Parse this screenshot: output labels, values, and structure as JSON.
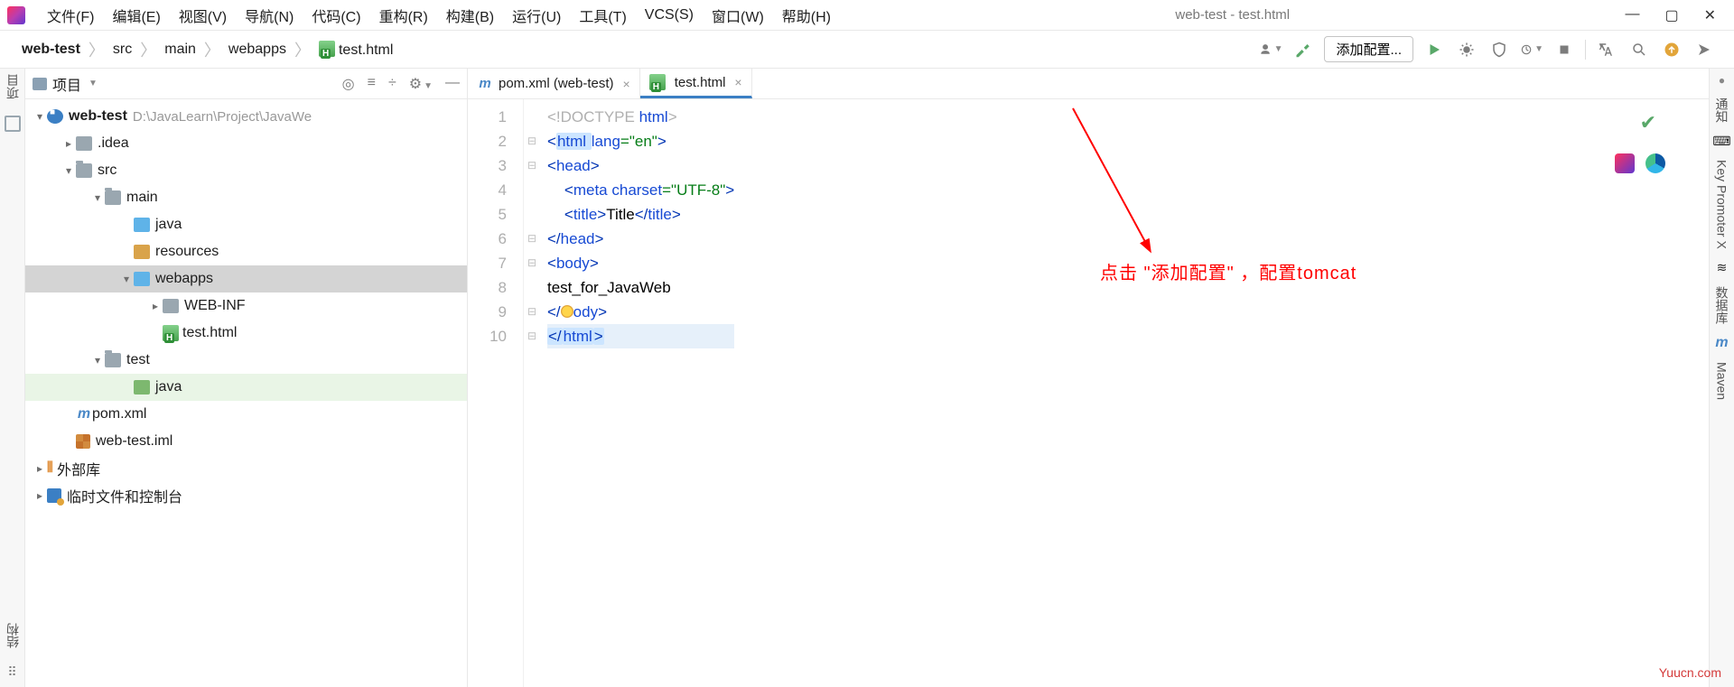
{
  "window": {
    "title": "web-test - test.html"
  },
  "menu": [
    "文件(F)",
    "编辑(E)",
    "视图(V)",
    "导航(N)",
    "代码(C)",
    "重构(R)",
    "构建(B)",
    "运行(U)",
    "工具(T)",
    "VCS(S)",
    "窗口(W)",
    "帮助(H)"
  ],
  "breadcrumb": [
    "web-test",
    "src",
    "main",
    "webapps",
    "test.html"
  ],
  "toolbar": {
    "add_config": "添加配置..."
  },
  "left_rail": {
    "project": "项目",
    "structure": "结构"
  },
  "panel": {
    "title": "项目"
  },
  "tree": {
    "root": "web-test",
    "root_path": "D:\\JavaLearn\\Project\\JavaWe",
    "idea": ".idea",
    "src": "src",
    "main": "main",
    "java": "java",
    "resources": "resources",
    "webapps": "webapps",
    "webinf": "WEB-INF",
    "testhtml": "test.html",
    "test": "test",
    "testjava": "java",
    "pom": "pom.xml",
    "iml": "web-test.iml",
    "extlib": "外部库",
    "scratch": "临时文件和控制台"
  },
  "tabs": {
    "pom": "pom.xml (web-test)",
    "test": "test.html"
  },
  "code": {
    "l1a": "<!",
    "l1b": "DOCTYPE ",
    "l1c": "html",
    "l1d": ">",
    "l2a": "<",
    "l2b": "html ",
    "l2c": "lang",
    "l2d": "=\"en\"",
    "l2e": ">",
    "l3a": "<",
    "l3b": "head",
    "l3c": ">",
    "l4a": "    <",
    "l4b": "meta ",
    "l4c": "charset",
    "l4d": "=\"UTF-8\"",
    "l4e": ">",
    "l5a": "    <",
    "l5b": "title",
    "l5c": ">",
    "l5d": "Title",
    "l5e": "</",
    "l5f": "title",
    "l5g": ">",
    "l6a": "</",
    "l6b": "head",
    "l6c": ">",
    "l7a": "<",
    "l7b": "body",
    "l7c": ">",
    "l8": "test_for_JavaWeb",
    "l9a": "</",
    "l9b": "ody",
    "l9c": ">",
    "l10a": "</",
    "l10b": "html",
    "l10c": ">"
  },
  "lines": [
    "1",
    "2",
    "3",
    "4",
    "5",
    "6",
    "7",
    "8",
    "9",
    "10"
  ],
  "annotation": "点击 \"添加配置\" ，配置tomcat",
  "right_rail": {
    "notify": "通知",
    "keypromoter": "Key Promoter X",
    "db": "数据库",
    "maven": "Maven"
  },
  "footer": "Yuucn.com"
}
